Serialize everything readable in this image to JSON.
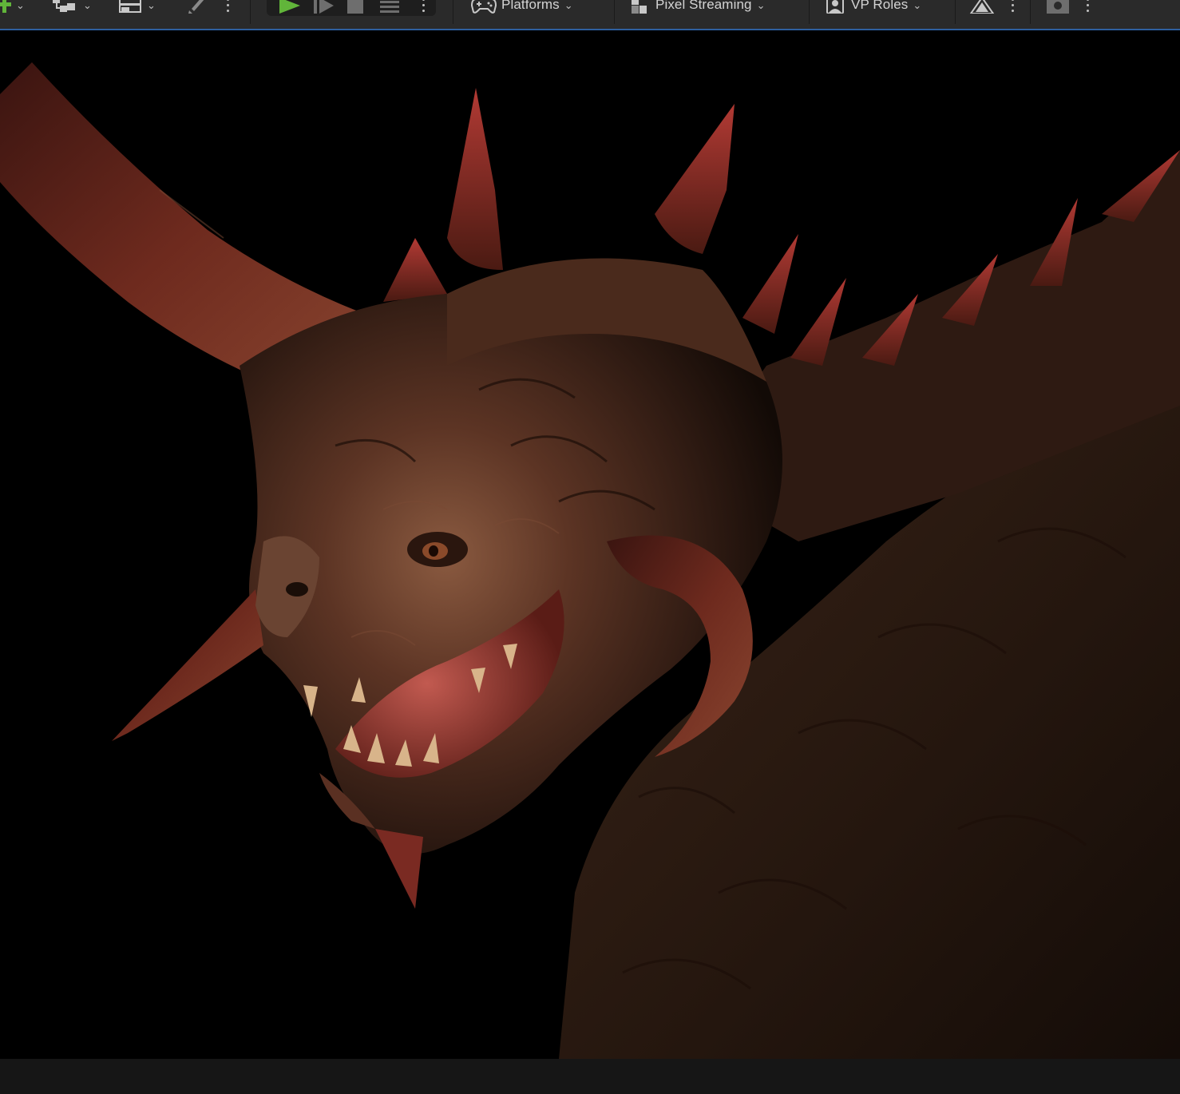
{
  "toolbar": {
    "platforms_label": "Platforms",
    "pixel_streaming_label": "Pixel Streaming",
    "vp_roles_label": "VP Roles",
    "icons": {
      "add": "plus-icon",
      "blueprint": "blueprint-icon",
      "layout": "layout-icon",
      "tools": "brush-icon",
      "play": "play-icon",
      "advance": "frame-advance-icon",
      "stop": "stop-icon",
      "eject": "eject-icon",
      "platforms": "gamepad-icon",
      "pixel_streaming": "pixel-streaming-icon",
      "vp_roles": "user-role-icon",
      "render": "triangle-icon",
      "camera": "camera-icon"
    },
    "colors": {
      "accent_green": "#61b53a",
      "toolbar_bg": "#2a2a2a",
      "viewport_border": "#2e5f9f"
    }
  },
  "viewport": {
    "content": "creature-render"
  }
}
